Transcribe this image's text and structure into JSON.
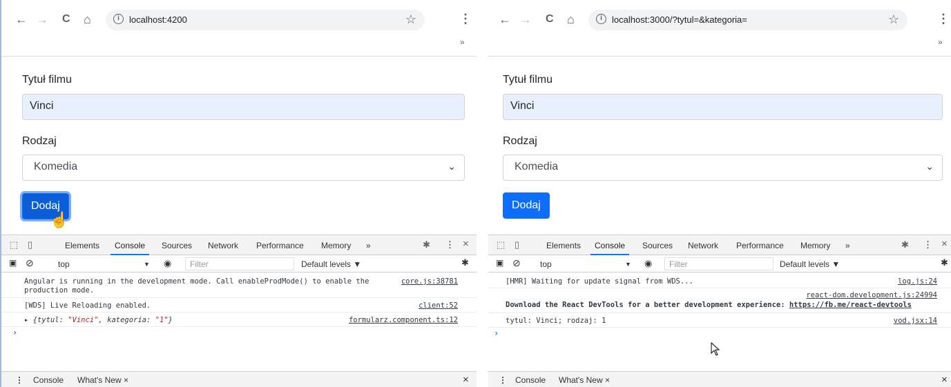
{
  "left": {
    "url": "localhost:4200",
    "form": {
      "title_label": "Tytuł filmu",
      "title_value": "Vinci",
      "genre_label": "Rodzaj",
      "genre_value": "Komedia",
      "submit_label": "Dodaj"
    },
    "devtools": {
      "tabs": [
        "Elements",
        "Console",
        "Sources",
        "Network",
        "Performance",
        "Memory"
      ],
      "context": "top",
      "filter_placeholder": "Filter",
      "levels": "Default levels ▼",
      "lines": [
        {
          "msg": "Angular is running in the development mode. Call enableProdMode() to enable the",
          "msg2": "production mode.",
          "src": "core.js:38781"
        },
        {
          "msg": "[WDS] Live Reloading enabled.",
          "src": "client:52"
        },
        {
          "obj_open": "▸ {tytul: ",
          "obj_v1": "\"Vinci\"",
          "obj_mid": ", kategoria: ",
          "obj_v2": "\"1\"",
          "obj_close": "}",
          "src": "formularz.component.ts:12"
        }
      ],
      "drawer": [
        "Console",
        "What's New ×"
      ]
    }
  },
  "right": {
    "url": "localhost:3000/?tytul=&kategoria=",
    "form": {
      "title_label": "Tytuł filmu",
      "title_value": "Vinci",
      "genre_label": "Rodzaj",
      "genre_value": "Komedia",
      "submit_label": "Dodaj"
    },
    "devtools": {
      "tabs": [
        "Elements",
        "Console",
        "Sources",
        "Network",
        "Performance",
        "Memory"
      ],
      "context": "top",
      "filter_placeholder": "Filter",
      "levels": "Default levels ▼",
      "lines": [
        {
          "msg": "[HMR] Waiting for update signal from WDS...",
          "src": "log.js:24"
        },
        {
          "src": "react-dom.development.js:24994",
          "msg": "Download the React DevTools for a better development experience: ",
          "link": "https://fb.me/react-devtools"
        },
        {
          "msg": "tytul: Vinci; rodzaj: 1",
          "src": "vod.jsx:14"
        }
      ],
      "drawer": [
        "Console",
        "What's New ×"
      ]
    }
  },
  "icons": {
    "back": "←",
    "forward": "→",
    "reload": "C",
    "home": "⌂",
    "info": "i",
    "star": "☆",
    "menu": "⋮",
    "chevrons": "»",
    "select_chevron": "⌄",
    "close": "×",
    "gear": "✱",
    "more_tabs": "»",
    "prompt": "›",
    "eye": "◉",
    "block": "⊘",
    "sidebar": "▣",
    "inspect": "⬚",
    "device": "▯"
  }
}
